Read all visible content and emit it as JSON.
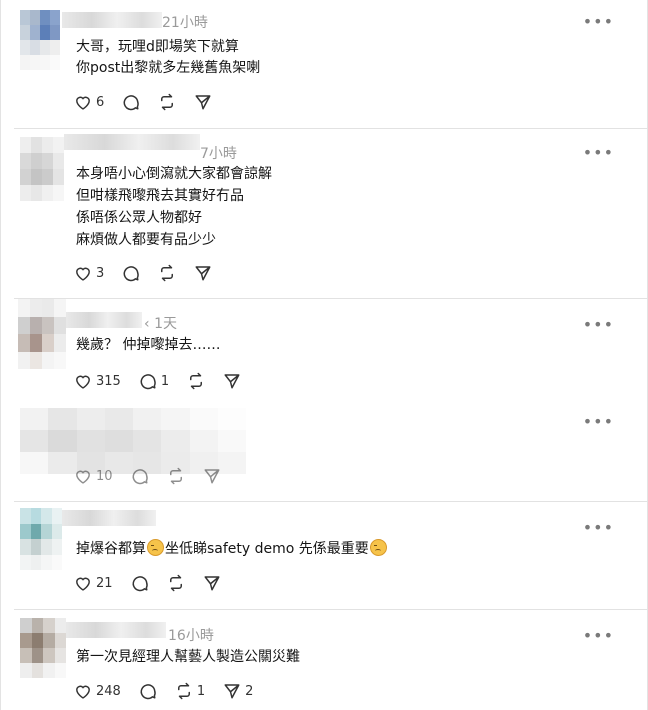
{
  "comments": [
    {
      "time": "21小時",
      "lines": [
        "大哥，玩哩d即場笑下就算",
        "你post出黎就多左幾舊魚架喇"
      ],
      "likes": "6",
      "replies": "",
      "reposts": "",
      "shares": ""
    },
    {
      "time": "7小時",
      "lines": [
        "本身唔小心倒瀉就大家都會諒解",
        "但咁樣飛嚟飛去其實好冇品",
        "係唔係公眾人物都好",
        "麻煩做人都要有品少少"
      ],
      "likes": "3",
      "replies": "",
      "reposts": "",
      "shares": ""
    },
    {
      "time": "1天",
      "lines": [
        "幾歲？ 仲掉嚟掉去……"
      ],
      "likes": "315",
      "replies": "1",
      "reposts": "",
      "shares": ""
    },
    {
      "time": "",
      "lines": [],
      "likes": "10",
      "replies": "",
      "reposts": "",
      "shares": ""
    },
    {
      "time": "",
      "line_a": "掉爆谷都算",
      "line_b": "坐低睇safety demo 先係最重要",
      "likes": "21",
      "replies": "",
      "reposts": "",
      "shares": ""
    },
    {
      "time": "16小時",
      "lines": [
        "第一次見經理人幫藝人製造公關災難"
      ],
      "likes": "248",
      "replies": "",
      "reposts": "1",
      "shares": "2"
    }
  ],
  "icons": {
    "like": "heart-outline-icon",
    "reply": "speech-bubble-icon",
    "repost": "repost-arrows-icon",
    "share": "paper-plane-icon",
    "more": "more-dots-icon"
  },
  "colors": {
    "text": "#151515",
    "muted": "#9a9a9a",
    "divider": "#e2e2e2",
    "emoji": "#f6c34a"
  }
}
